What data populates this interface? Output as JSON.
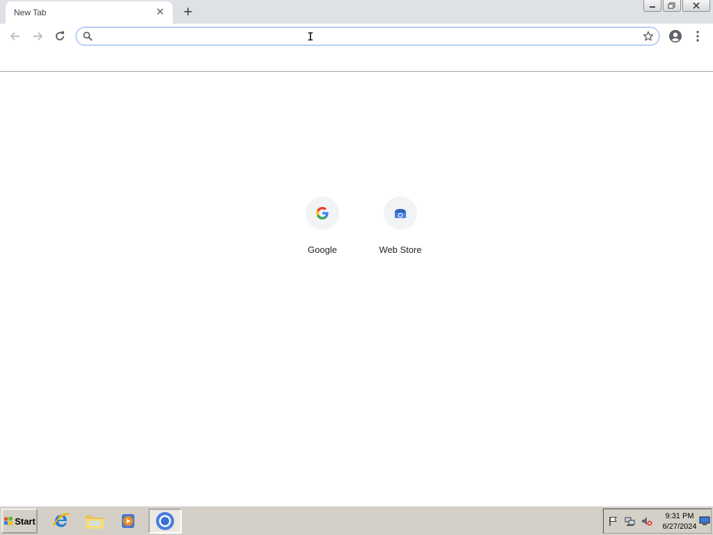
{
  "browser": {
    "tab": {
      "title": "New Tab",
      "close_icon": "close-icon"
    },
    "new_tab_icon": "plus-icon",
    "window_controls": [
      "minimize-icon",
      "restore-icon",
      "close-icon"
    ]
  },
  "toolbar": {
    "back_icon": "arrow-left-icon",
    "forward_icon": "arrow-right-icon",
    "reload_icon": "reload-icon",
    "omnibox": {
      "value": "",
      "placeholder": "",
      "search_icon": "search-icon",
      "bookmark_icon": "star-icon"
    },
    "profile_icon": "account-circle-icon",
    "menu_icon": "vertical-dots-icon"
  },
  "new_tab_page": {
    "shortcuts": [
      {
        "label": "Google",
        "icon": "google-g-icon"
      },
      {
        "label": "Web Store",
        "icon": "chrome-web-store-icon"
      }
    ]
  },
  "taskbar": {
    "start_label": "Start",
    "pinned": [
      "internet-explorer-icon",
      "file-explorer-icon",
      "media-player-icon",
      "chrome-icon"
    ],
    "active_app": "chrome-icon",
    "tray_icons": [
      "action-center-flag-icon",
      "network-icon",
      "volume-muted-icon"
    ],
    "clock": {
      "time": "9:31 PM",
      "date": "6/27/2024"
    },
    "show_desktop_icon": "show-desktop-icon"
  },
  "colors": {
    "tabstrip_bg": "#dee1e6",
    "omnibox_focus": "#a8c7fa",
    "taskbar_bg": "#d4d0c8",
    "google_blue": "#4285f4",
    "google_red": "#ea4335",
    "google_yellow": "#fbbc05",
    "google_green": "#34a853"
  }
}
